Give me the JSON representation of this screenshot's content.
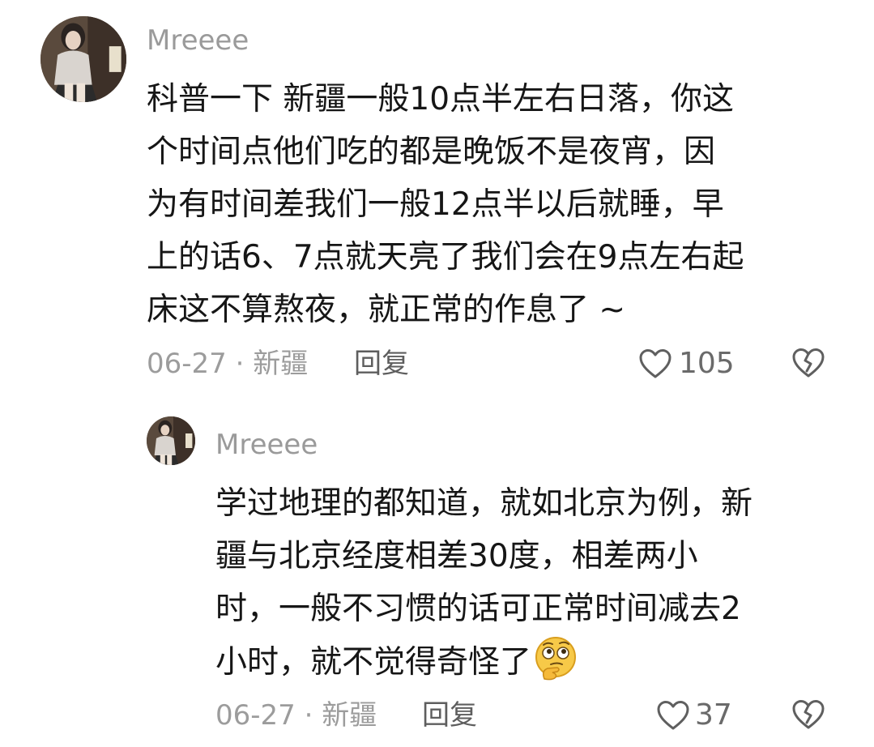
{
  "comment": {
    "username": "Mreeee",
    "text_lines": [
      "科普一下 新疆一般10点半左右日落，你这",
      "个时间点他们吃的都是晚饭不是夜宵，因",
      "为有时间差我们一般12点半以后就睡，早",
      "上的话6、7点就天亮了我们会在9点左右起",
      "床这不算熬夜，就正常的作息了 ~"
    ],
    "date": "06-27",
    "separator": "·",
    "location": "新疆",
    "reply_label": "回复",
    "likes": "105",
    "like_icon": "heart-outline-icon",
    "dislike_icon": "broken-heart-icon"
  },
  "reply": {
    "username": "Mreeee",
    "text_lines": [
      "学过地理的都知道，就如北京为例，新",
      "疆与北京经度相差30度，相差两小",
      "时，一般不习惯的话可正常时间减去2",
      "小时，就不觉得奇怪了"
    ],
    "emoji": "thinking-face-emoji",
    "date": "06-27",
    "separator": "·",
    "location": "新疆",
    "reply_label": "回复",
    "likes": "37",
    "like_icon": "heart-outline-icon",
    "dislike_icon": "broken-heart-icon"
  }
}
